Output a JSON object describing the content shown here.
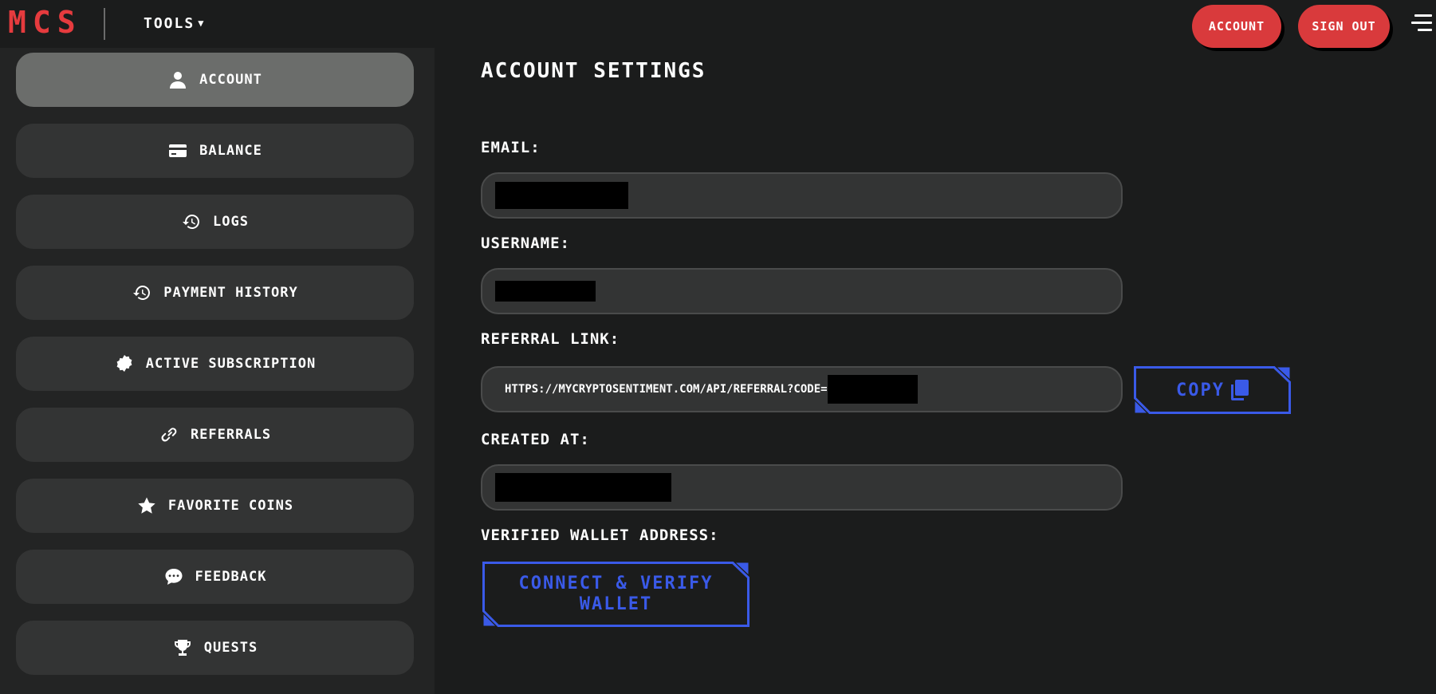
{
  "brand": {
    "logo_text": "MCS",
    "logo_color": "#e63b3e"
  },
  "header": {
    "tools_label": "TOOLS",
    "account_button": "ACCOUNT",
    "signout_button": "SIGN OUT",
    "menu_icon": "hamburger-icon"
  },
  "sidebar": {
    "items": [
      {
        "label": "ACCOUNT",
        "icon": "user-icon",
        "active": true
      },
      {
        "label": "BALANCE",
        "icon": "credit-card-icon",
        "active": false
      },
      {
        "label": "LOGS",
        "icon": "history-icon",
        "active": false
      },
      {
        "label": "PAYMENT HISTORY",
        "icon": "history-icon",
        "active": false
      },
      {
        "label": "ACTIVE SUBSCRIPTION",
        "icon": "badge-icon",
        "active": false
      },
      {
        "label": "REFERRALS",
        "icon": "link-icon",
        "active": false
      },
      {
        "label": "FAVORITE COINS",
        "icon": "star-icon",
        "active": false
      },
      {
        "label": "FEEDBACK",
        "icon": "chat-icon",
        "active": false
      },
      {
        "label": "QUESTS",
        "icon": "trophy-icon",
        "active": false
      }
    ]
  },
  "main": {
    "title": "ACCOUNT SETTINGS",
    "email": {
      "label": "EMAIL:"
    },
    "username": {
      "label": "USERNAME:"
    },
    "referral": {
      "label": "REFERRAL LINK:",
      "value": "HTTPS://MYCRYPTOSENTIMENT.COM/API/REFERRAL?CODE=",
      "copy_button": "COPY"
    },
    "created_at": {
      "label": "CREATED AT:"
    },
    "wallet": {
      "label": "VERIFIED WALLET ADDRESS:",
      "button": "CONNECT & VERIFY WALLET"
    }
  },
  "colors": {
    "accent_red": "#d93a3c",
    "accent_blue": "#3a5ae8",
    "background": "#1b1c1c",
    "sidebar": "#232424"
  }
}
